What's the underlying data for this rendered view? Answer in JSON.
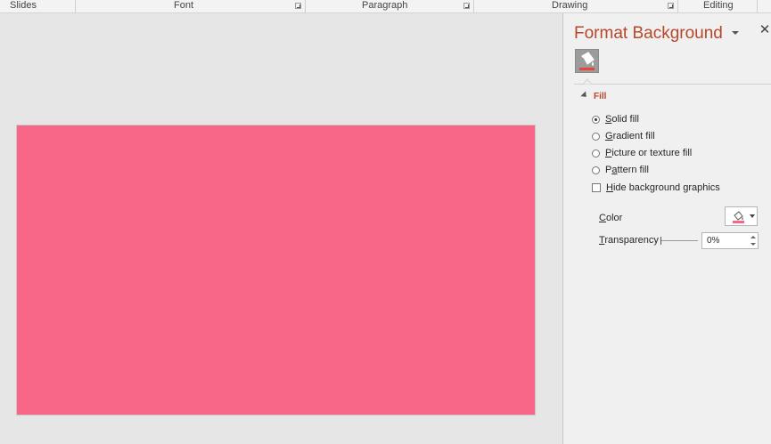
{
  "ribbon": {
    "groups": [
      {
        "label": "Slides"
      },
      {
        "label": "Font"
      },
      {
        "label": "Paragraph"
      },
      {
        "label": "Drawing"
      },
      {
        "label": "Editing"
      }
    ]
  },
  "slide": {
    "background_color": "#f86688"
  },
  "pane": {
    "title": "Format Background",
    "close_glyph": "✕",
    "tab_icon": "paint-bucket-icon",
    "section_label": "Fill",
    "options": [
      {
        "label": "Solid fill",
        "selected": true
      },
      {
        "label": "Gradient fill",
        "selected": false
      },
      {
        "label": "Picture or texture fill",
        "selected": false
      },
      {
        "label": "Pattern fill",
        "selected": false
      }
    ],
    "hide_graphics_label": "Hide background graphics",
    "hide_graphics_checked": false,
    "color_label": "Color",
    "transparency_label": "Transparency",
    "transparency_value": "0%",
    "accent_color": "#b7472a",
    "selected_color": "#f86688"
  }
}
